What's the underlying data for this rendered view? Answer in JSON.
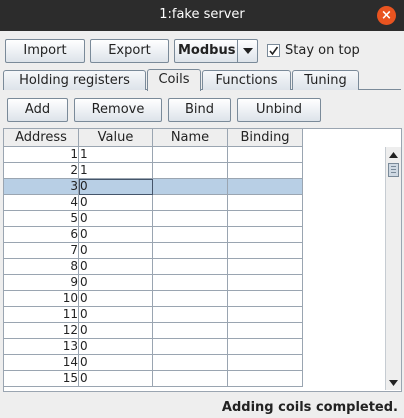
{
  "window": {
    "title": "1:fake server"
  },
  "toolbar": {
    "import_label": "Import",
    "export_label": "Export",
    "protocol_value": "Modbus",
    "stay_on_top_label": "Stay on top",
    "stay_on_top_checked": true
  },
  "tabs": [
    {
      "label": "Holding registers",
      "active": false
    },
    {
      "label": "Coils",
      "active": true
    },
    {
      "label": "Functions",
      "active": false
    },
    {
      "label": "Tuning",
      "active": false
    }
  ],
  "actions": {
    "add_label": "Add",
    "remove_label": "Remove",
    "bind_label": "Bind",
    "unbind_label": "Unbind"
  },
  "table": {
    "headers": [
      "Address",
      "Value",
      "Name",
      "Binding"
    ],
    "selected_row_index": 2,
    "rows": [
      {
        "address": "1",
        "value": "1",
        "name": "",
        "binding": ""
      },
      {
        "address": "2",
        "value": "1",
        "name": "",
        "binding": ""
      },
      {
        "address": "3",
        "value": "0",
        "name": "",
        "binding": ""
      },
      {
        "address": "4",
        "value": "0",
        "name": "",
        "binding": ""
      },
      {
        "address": "5",
        "value": "0",
        "name": "",
        "binding": ""
      },
      {
        "address": "6",
        "value": "0",
        "name": "",
        "binding": ""
      },
      {
        "address": "7",
        "value": "0",
        "name": "",
        "binding": ""
      },
      {
        "address": "8",
        "value": "0",
        "name": "",
        "binding": ""
      },
      {
        "address": "9",
        "value": "0",
        "name": "",
        "binding": ""
      },
      {
        "address": "10",
        "value": "0",
        "name": "",
        "binding": ""
      },
      {
        "address": "11",
        "value": "0",
        "name": "",
        "binding": ""
      },
      {
        "address": "12",
        "value": "0",
        "name": "",
        "binding": ""
      },
      {
        "address": "13",
        "value": "0",
        "name": "",
        "binding": ""
      },
      {
        "address": "14",
        "value": "0",
        "name": "",
        "binding": ""
      },
      {
        "address": "15",
        "value": "0",
        "name": "",
        "binding": ""
      }
    ]
  },
  "status": {
    "message": "Adding coils completed."
  },
  "colors": {
    "titlebar": "#2c2c2c",
    "close_button": "#e95420",
    "selection": "#b8cfe5"
  }
}
